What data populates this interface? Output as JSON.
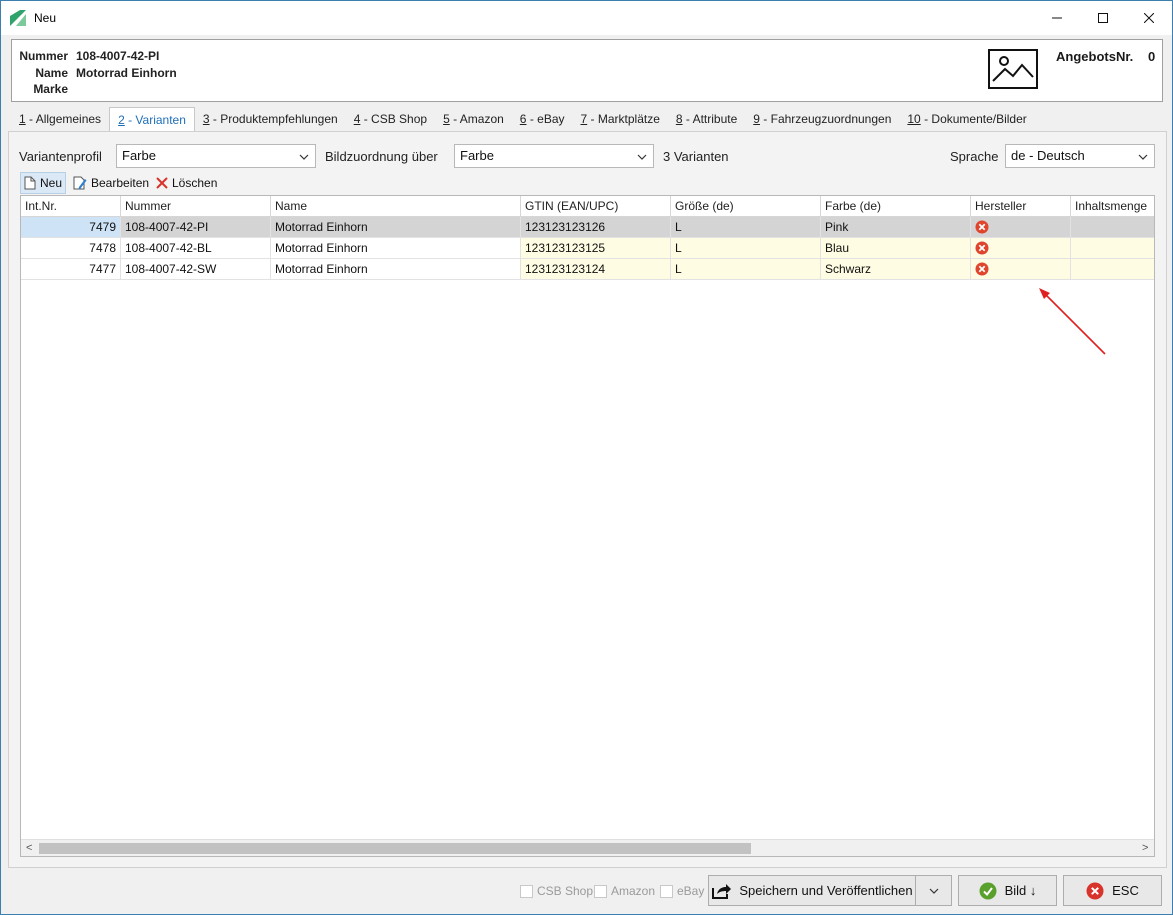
{
  "window": {
    "title": "Neu"
  },
  "header": {
    "nummer_label": "Nummer",
    "nummer_value": "108-4007-42-PI",
    "name_label": "Name",
    "name_value": "Motorrad Einhorn",
    "marke_label": "Marke",
    "marke_value": "",
    "angebots_label": "AngebotsNr.",
    "angebots_value": "0"
  },
  "tabs": [
    {
      "key": "1",
      "label": " - Allgemeines"
    },
    {
      "key": "2",
      "label": " - Varianten"
    },
    {
      "key": "3",
      "label": " - Produktempfehlungen"
    },
    {
      "key": "4",
      "label": " - CSB Shop"
    },
    {
      "key": "5",
      "label": " - Amazon"
    },
    {
      "key": "6",
      "label": " - eBay"
    },
    {
      "key": "7",
      "label": " - Marktplätze"
    },
    {
      "key": "8",
      "label": " - Attribute"
    },
    {
      "key": "9",
      "label": " - Fahrzeugzuordnungen"
    },
    {
      "key": "10",
      "label": " - Dokumente/Bilder"
    }
  ],
  "filters": {
    "variantenprofil_label": "Variantenprofil",
    "variantenprofil_value": "Farbe",
    "bildzuordnung_label": "Bildzuordnung über",
    "bildzuordnung_value": "Farbe",
    "count_text": "3 Varianten",
    "sprache_label": "Sprache",
    "sprache_value": "de - Deutsch"
  },
  "toolbar": {
    "neu": "Neu",
    "bearbeiten": "Bearbeiten",
    "loeschen": "Löschen"
  },
  "grid": {
    "columns": [
      "Int.Nr.",
      "Nummer",
      "Name",
      "GTIN (EAN/UPC)",
      "Größe (de)",
      "Farbe (de)",
      "Hersteller",
      "Inhaltsmenge"
    ],
    "rows": [
      {
        "intnr": "7479",
        "nummer": "108-4007-42-PI",
        "name": "Motorrad Einhorn",
        "gtin": "123123123126",
        "groesse": "L",
        "farbe": "Pink",
        "hersteller_icon": "error-icon"
      },
      {
        "intnr": "7478",
        "nummer": "108-4007-42-BL",
        "name": "Motorrad Einhorn",
        "gtin": "123123123125",
        "groesse": "L",
        "farbe": "Blau",
        "hersteller_icon": "error-icon"
      },
      {
        "intnr": "7477",
        "nummer": "108-4007-42-SW",
        "name": "Motorrad Einhorn",
        "gtin": "123123123124",
        "groesse": "L",
        "farbe": "Schwarz",
        "hersteller_icon": "error-icon"
      }
    ]
  },
  "footer": {
    "chk_csb": "CSB Shop",
    "chk_amazon": "Amazon",
    "chk_ebay": "eBay",
    "save_publish": "Speichern und Veröffentlichen",
    "bild": "Bild ↓",
    "esc": "ESC"
  },
  "colors": {
    "accent": "#1e6fb8",
    "selected_row": "#d4d4d4",
    "editable_cell": "#fefce2",
    "error": "#e0442c",
    "ok": "#5aa02c",
    "annotation_arrow": "#e02020"
  }
}
